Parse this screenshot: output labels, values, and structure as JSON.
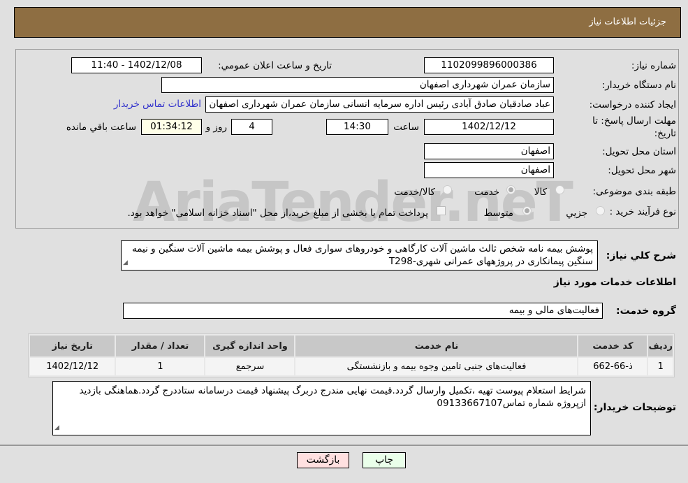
{
  "header": {
    "title": "جزئیات اطلاعات نیاز"
  },
  "form": {
    "need_number_label": "شماره نیاز:",
    "need_number": "1102099896000386",
    "announce_label": "تاریخ و ساعت اعلان عمومي:",
    "announce_value": "1402/12/08 - 11:40",
    "buyer_org_label": "نام دستگاه خریدار:",
    "buyer_org": "سازمان عمران شهرداری اصفهان",
    "creator_label": "ایجاد کننده درخواست:",
    "creator": "عباد صادقیان صادق آبادی رئیس اداره سرمایه انسانی سازمان عمران شهرداری اصفهان",
    "contact_link": "اطلاعات تماس خریدار",
    "deadline_label": "مهلت ارسال پاسخ: تا تاریخ:",
    "deadline_date": "1402/12/12",
    "time_label": "ساعت",
    "deadline_time": "14:30",
    "days": "4",
    "days_label": "روز و",
    "remaining": "01:34:12",
    "remaining_label": "ساعت باقي مانده",
    "province_label": "استان محل تحویل:",
    "province": "اصفهان",
    "city_label": "شهر محل تحویل:",
    "city": "اصفهان",
    "category_label": "طبقه بندی موضوعی:",
    "category_options": [
      "کالا",
      "خدمت",
      "کالا/خدمت"
    ],
    "category_selected": "خدمت",
    "process_label": "نوع فرآیند خرید :",
    "process_options": [
      "جزیي",
      "متوسط"
    ],
    "process_selected": "متوسط",
    "payment_note": "پرداخت تمام یا بخشی از مبلغ خرید،از محل \"اسناد خزانه اسلامی\" خواهد بود."
  },
  "description": {
    "label": "شرح کلي نیاز:",
    "text": "پوشش بیمه نامه شخص ثالث ماشین آلات کارگاهی و خودروهای سواری فعال و پوشش بیمه ماشین آلات سنگین و نیمه سنگین پیمانکاری در پروژههای عمرانی شهری-T298"
  },
  "services": {
    "title": "اطلاعات خدمات مورد نیاز",
    "group_label": "گروه خدمت:",
    "group": "فعالیت‌های مالی و بیمه",
    "columns": [
      "ردیف",
      "کد خدمت",
      "نام خدمت",
      "واحد اندازه گیری",
      "تعداد / مقدار",
      "تاریخ نیاز"
    ],
    "rows": [
      [
        "1",
        "ذ-66-662",
        "فعالیت‌های جنبی تامین وجوه بیمه و بازنشستگی",
        "سرجمع",
        "1",
        "1402/12/12"
      ]
    ]
  },
  "notes": {
    "label": "توضیحات خریدار:",
    "text": "شرایط استعلام پیوست تهیه ،تکمیل وارسال گردد.قیمت نهایی مندرج دربرگ پیشنهاد قیمت درسامانه ستاددرج گردد.هماهنگی بازدید ازپروژه شماره تماس09133667107"
  },
  "buttons": {
    "print": "چاپ",
    "back": "بازگشت"
  },
  "watermark": "AriaTender.neT",
  "colors": {
    "header": "#8e6e42",
    "link": "#3333cc",
    "remaining_bg": "#ffffe8",
    "print_bg": "#eaffea",
    "back_bg": "#ffe0e0"
  }
}
